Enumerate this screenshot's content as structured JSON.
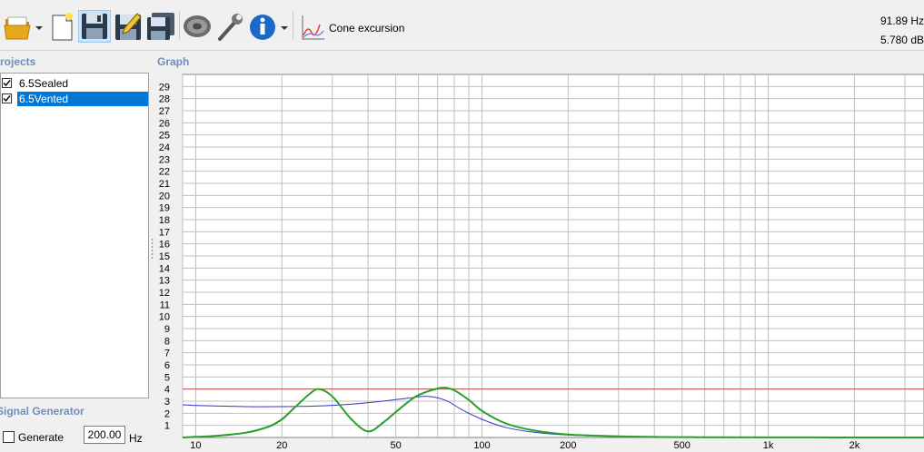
{
  "toolbar": {
    "mode_label": "Cone excursion",
    "buttons": [
      "open-folder-icon",
      "new-project-icon",
      "save-icon",
      "save-as-icon",
      "save-all-icon",
      "speaker-driver-icon",
      "wrench-icon",
      "info-icon"
    ]
  },
  "readout": {
    "frequency": "91.89 Hz",
    "value": "5.780 dB"
  },
  "projects": {
    "title": "Projects",
    "items": [
      {
        "label": "6.5Sealed",
        "checked": true,
        "selected": false
      },
      {
        "label": "6.5Vented",
        "checked": true,
        "selected": true
      }
    ]
  },
  "graph": {
    "title": "Graph"
  },
  "signal_generator": {
    "title": "Signal Generator",
    "generate_label": "Generate",
    "generate_checked": false,
    "frequency_value": "200.00",
    "unit": "Hz"
  },
  "colors": {
    "grid": "#c0c0c0",
    "limit_line": "#c0504d",
    "sealed_series": "#3535c8",
    "vented_series": "#27a02a",
    "selection": "#0078d7",
    "section_label": "#6d8fb8"
  },
  "chart_data": {
    "type": "line",
    "x_scale": "log",
    "xlim": [
      9,
      3500
    ],
    "ylim": [
      0,
      30
    ],
    "x_tick_labels": [
      {
        "value": 10,
        "label": "10"
      },
      {
        "value": 20,
        "label": "20"
      },
      {
        "value": 50,
        "label": "50"
      },
      {
        "value": 100,
        "label": "100"
      },
      {
        "value": 200,
        "label": "200"
      },
      {
        "value": 500,
        "label": "500"
      },
      {
        "value": 1000,
        "label": "1k"
      },
      {
        "value": 2000,
        "label": "2k"
      }
    ],
    "y_ticks": [
      1,
      2,
      3,
      4,
      5,
      6,
      7,
      8,
      9,
      10,
      11,
      12,
      13,
      14,
      15,
      16,
      17,
      18,
      19,
      20,
      21,
      22,
      23,
      24,
      25,
      26,
      27,
      28,
      29
    ],
    "grid": true,
    "limit_line": 4.0,
    "series": [
      {
        "x": [
          9,
          10,
          15,
          20,
          27,
          35,
          45,
          55,
          65,
          75,
          85,
          100,
          120,
          150,
          200,
          300,
          500,
          1000,
          3500
        ],
        "y": [
          2.7,
          2.65,
          2.55,
          2.55,
          2.6,
          2.75,
          3.0,
          3.25,
          3.4,
          3.05,
          2.3,
          1.5,
          0.85,
          0.45,
          0.2,
          0.08,
          0.03,
          0.01,
          0.0
        ]
      },
      {
        "x": [
          9,
          10,
          12,
          15,
          18,
          20,
          22,
          25,
          27,
          30,
          35,
          40,
          45,
          50,
          55,
          60,
          70,
          75,
          80,
          90,
          100,
          120,
          150,
          200,
          300,
          500,
          1000,
          3500
        ],
        "y": [
          0.0,
          0.05,
          0.15,
          0.4,
          0.9,
          1.5,
          2.4,
          3.6,
          4.0,
          3.4,
          1.5,
          0.5,
          1.2,
          2.1,
          2.9,
          3.5,
          4.05,
          4.1,
          3.9,
          3.1,
          2.2,
          1.2,
          0.6,
          0.25,
          0.1,
          0.03,
          0.01,
          0.0
        ]
      }
    ]
  }
}
